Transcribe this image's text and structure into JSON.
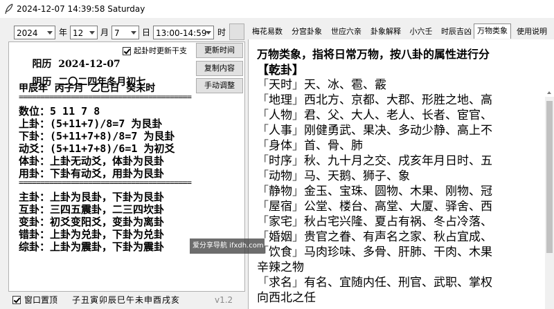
{
  "window": {
    "title": "2024-12-07 14:39:58 Saturday"
  },
  "controls": {
    "year": "2024",
    "year_unit": "年",
    "month": "12",
    "month_unit": "月",
    "day": "7",
    "day_unit": "日",
    "hour": "13:00-14:59",
    "hour_unit": "时"
  },
  "left": {
    "solar_label": "阳历",
    "solar_date": "2024-12-07",
    "auto_update_label": "起卦时更新干支",
    "auto_update_checked": true,
    "update_time_btn": "更新时间",
    "lunar_label": "阴历",
    "lunar_date": "二〇二四年冬月初七",
    "copy_btn": "复制内容",
    "ganzhi": "甲辰年  丙子月  乙巳日  癸未时",
    "manual_btn": "手动调整",
    "lines1": [
      "数位：5 11 7 8",
      "上卦：(5+11+7)/8=7 为艮卦",
      "下卦：(5+11+7+8)/8=7 为艮卦",
      "动爻：(5+11+7+8)/6=1 为初爻",
      "体卦：上卦无动爻，体卦为艮卦",
      "用卦：下卦有动爻，用卦为艮卦"
    ],
    "separator": "========================================",
    "lines2": [
      "主卦：上卦为艮卦，下卦为艮卦",
      "互卦：三四五震卦，二三四坎卦",
      "变卦：初爻变阳爻，变卦为离卦",
      "错卦：上卦为兑卦，下卦为兑卦",
      "综卦：上卦为震卦，下卦为震卦"
    ]
  },
  "tabs": [
    {
      "label": "梅花易数",
      "active": false
    },
    {
      "label": "分宫卦象",
      "active": false
    },
    {
      "label": "世应六亲",
      "active": false
    },
    {
      "label": "卦象解释",
      "active": false
    },
    {
      "label": "小六壬",
      "active": false
    },
    {
      "label": "时辰吉凶",
      "active": false
    },
    {
      "label": "万物类象",
      "active": true
    },
    {
      "label": "使用说明",
      "active": false
    }
  ],
  "right": {
    "heading": "万物类象，指将日常万物，按八卦的属性进行分",
    "section_title": "【乾卦】",
    "entries": [
      {
        "key": "天时",
        "text": "天、冰、雹、霰"
      },
      {
        "key": "地理",
        "text": "西北方、京都、大郡、形胜之地、高"
      },
      {
        "key": "人物",
        "text": "君、父、大人、老人、长者、宦官、"
      },
      {
        "key": "人事",
        "text": "刚健勇武、果决、多动少静、高上不"
      },
      {
        "key": "身体",
        "text": "首、骨、肺"
      },
      {
        "key": "时序",
        "text": "秋、九十月之交、戌亥年月日时、五"
      },
      {
        "key": "动物",
        "text": "马、天鹅、狮子、象"
      },
      {
        "key": "静物",
        "text": "金玉、宝珠、圆物、木果、刚物、冠"
      },
      {
        "key": "屋宿",
        "text": "公堂、楼台、高堂、大厦、驿舍、西"
      },
      {
        "key": "家宅",
        "text": "秋占宅兴隆、夏占有祸、冬占冷落、"
      },
      {
        "key": "婚姻",
        "text": "贵官之眷、有声名之家、秋占宜成、"
      },
      {
        "key": "饮食",
        "text": "马肉珍味、多骨、肝肺、干肉、木果"
      }
    ],
    "cont1": "辛辣之物",
    "entry_more": {
      "key": "求名",
      "text": "有名、宜随内任、刑官、武职、掌权"
    },
    "cont2": "向西北之任"
  },
  "footer": {
    "on_top_label": "窗口置顶",
    "on_top_checked": true,
    "branches": "子丑寅卯辰巳午未申酉戌亥",
    "version": "v1.2"
  },
  "watermark": {
    "text": "爱分享导航 ifxdh.com"
  }
}
